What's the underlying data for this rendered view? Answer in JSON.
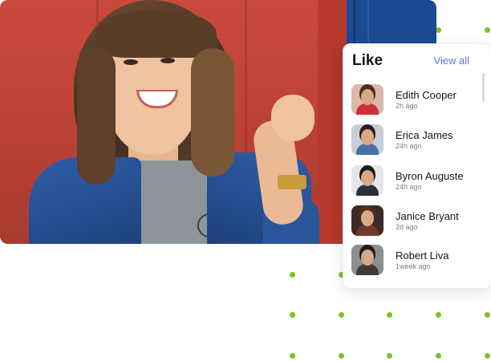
{
  "card": {
    "title": "Like",
    "view_all": "View all",
    "items": [
      {
        "name": "Edith Cooper",
        "time": "2h ago",
        "avatar_bg": "#d9b8a8",
        "avatar_hair": "#4a2d1f",
        "avatar_body": "#c9303b"
      },
      {
        "name": "Erica James",
        "time": "24h ago",
        "avatar_bg": "#c8cdd8",
        "avatar_hair": "#2a1f1c",
        "avatar_body": "#4a6fa5"
      },
      {
        "name": "Byron Auguste",
        "time": "24h ago",
        "avatar_bg": "#e4e6ea",
        "avatar_hair": "#1a1a1a",
        "avatar_body": "#2a2f3a"
      },
      {
        "name": "Janice Bryant",
        "time": "2d ago",
        "avatar_bg": "#3a2a28",
        "avatar_hair": "#5a2c1a",
        "avatar_body": "#6e3b2b"
      },
      {
        "name": "Robert Liva",
        "time": "1week ago",
        "avatar_bg": "#8a8f8f",
        "avatar_hair": "#231a16",
        "avatar_body": "#3f3a35"
      }
    ]
  },
  "colors": {
    "accent_link": "#5a78d6",
    "dot_green": "#7cc12a"
  }
}
